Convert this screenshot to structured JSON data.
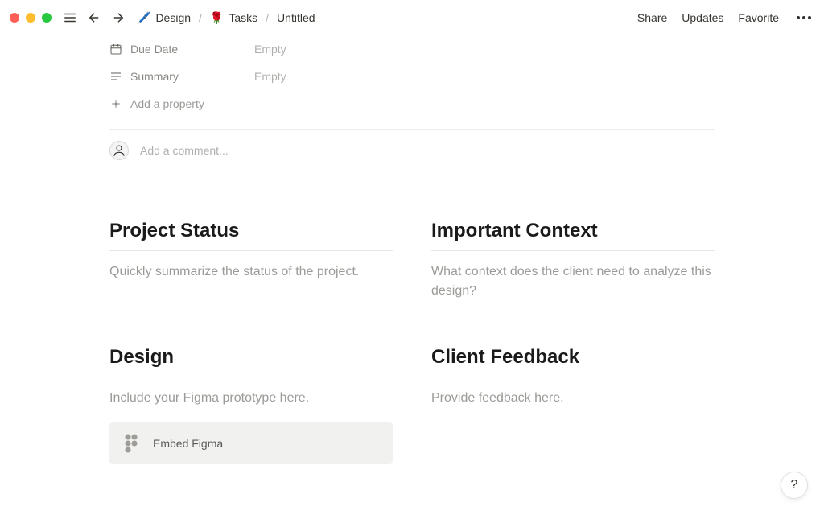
{
  "breadcrumb": {
    "design_icon": "🖊️",
    "design_label": "Design",
    "tasks_icon": "🌹",
    "tasks_label": "Tasks",
    "page_label": "Untitled"
  },
  "top_actions": {
    "share": "Share",
    "updates": "Updates",
    "favorite": "Favorite"
  },
  "properties": {
    "due_date": {
      "label": "Due Date",
      "value": "Empty"
    },
    "summary": {
      "label": "Summary",
      "value": "Empty"
    },
    "add": "Add a property"
  },
  "comment": {
    "placeholder": "Add a comment..."
  },
  "sections": {
    "project_status": {
      "title": "Project Status",
      "body": "Quickly summarize the status of the project."
    },
    "important_context": {
      "title": "Important Context",
      "body": "What context does the client need to analyze this design?"
    },
    "design": {
      "title": "Design",
      "body": "Include your Figma prototype here.",
      "embed_label": "Embed Figma"
    },
    "client_feedback": {
      "title": "Client Feedback",
      "body": "Provide feedback here."
    }
  },
  "help": "?"
}
